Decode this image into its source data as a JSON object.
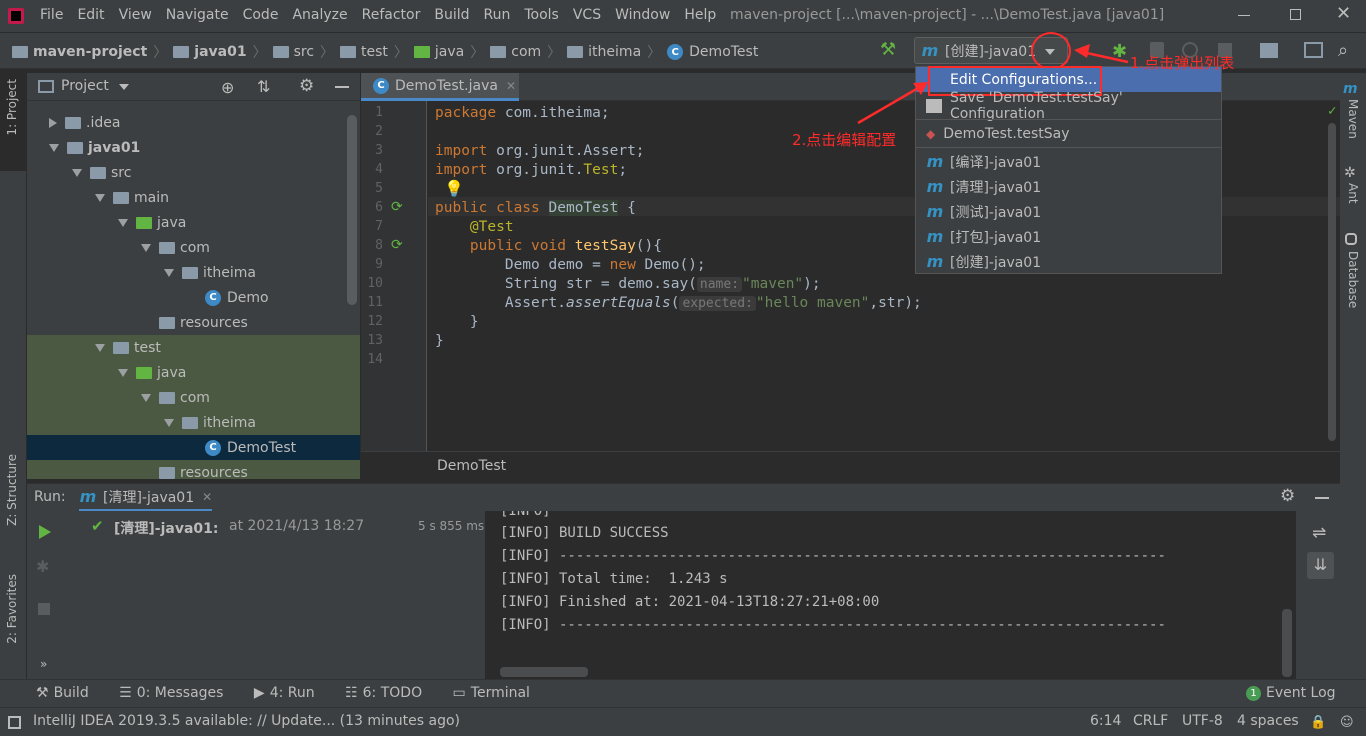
{
  "titlebar": {
    "menu": [
      "File",
      "Edit",
      "View",
      "Navigate",
      "Code",
      "Analyze",
      "Refactor",
      "Build",
      "Run",
      "Tools",
      "VCS",
      "Window",
      "Help"
    ],
    "window_title": "maven-project [...\\maven-project] - ...\\DemoTest.java [java01]"
  },
  "breadcrumbs": [
    "maven-project",
    "java01",
    "src",
    "test",
    "java",
    "com",
    "itheima",
    "DemoTest"
  ],
  "run_config": {
    "selected": "[创建]-java01"
  },
  "left_strip": {
    "project": "1: Project",
    "structure": "Z: Structure",
    "favorites": "2: Favorites"
  },
  "project_panel": {
    "title": "Project",
    "tree": [
      {
        "label": ".idea",
        "depth": 1,
        "expanded": false,
        "kind": "folder"
      },
      {
        "label": "java01",
        "depth": 1,
        "expanded": true,
        "kind": "module"
      },
      {
        "label": "src",
        "depth": 2,
        "expanded": true,
        "kind": "folder"
      },
      {
        "label": "main",
        "depth": 3,
        "expanded": true,
        "kind": "folder"
      },
      {
        "label": "java",
        "depth": 4,
        "expanded": true,
        "kind": "src"
      },
      {
        "label": "com",
        "depth": 5,
        "expanded": true,
        "kind": "pkg"
      },
      {
        "label": "itheima",
        "depth": 6,
        "expanded": true,
        "kind": "pkg"
      },
      {
        "label": "Demo",
        "depth": 7,
        "kind": "class"
      },
      {
        "label": "resources",
        "depth": 5,
        "kind": "res"
      },
      {
        "label": "test",
        "depth": 3,
        "expanded": true,
        "kind": "folder"
      },
      {
        "label": "java",
        "depth": 4,
        "expanded": true,
        "kind": "test"
      },
      {
        "label": "com",
        "depth": 5,
        "expanded": true,
        "kind": "pkg"
      },
      {
        "label": "itheima",
        "depth": 6,
        "expanded": true,
        "kind": "pkg"
      },
      {
        "label": "DemoTest",
        "depth": 7,
        "kind": "class",
        "selected": true
      },
      {
        "label": "resources",
        "depth": 5,
        "kind": "res"
      }
    ]
  },
  "editor": {
    "tab": "DemoTest.java",
    "status_breadcrumb": "DemoTest",
    "line_numbers": [
      "1",
      "2",
      "3",
      "4",
      "5",
      "6",
      "7",
      "8",
      "9",
      "10",
      "11",
      "12",
      "13",
      "14"
    ],
    "code": {
      "l1a": "package",
      "l1b": " com.itheima;",
      "l3a": "import",
      "l3b": " org.junit.Assert;",
      "l4a": "import",
      "l4b": " org.junit.",
      "l4c": "Test",
      ";": ";",
      "l6a": "public class ",
      "l6b": "DemoTest",
      " l6c": " {",
      "l7": "@Test",
      "l8a": "public void ",
      "l8b": "testSay",
      "l8c": "(){",
      "l9a": "Demo demo = ",
      "l9b": "new",
      "l9c": " Demo();",
      "l10a": "String str = demo.say(",
      "l10hint": "name:",
      "l10str": "\"maven\"",
      "l10end": ");",
      "l11a": "Assert.",
      "l11b": "assertEquals",
      "l11c": "(",
      "l11hint": "expected:",
      "l11str": "\"hello maven\"",
      "l11end": ",str);",
      "l12": "}",
      "l13": "}"
    }
  },
  "right_strip": {
    "maven": "Maven",
    "ant": "Ant",
    "database": "Database"
  },
  "popup": {
    "edit": "Edit Configurations...",
    "save": "Save 'DemoTest.testSay' Configuration",
    "demotest": "DemoTest.testSay",
    "items": [
      "[编译]-java01",
      "[清理]-java01",
      "[测试]-java01",
      "[打包]-java01",
      "[创建]-java01"
    ]
  },
  "annotations": {
    "a1": "1.点击弹出列表",
    "a2": "2.点击编辑配置"
  },
  "run_panel": {
    "label": "Run:",
    "tab": "[清理]-java01",
    "entry_name": "[清理]-java01:",
    "entry_time": "at 2021/4/13 18:27",
    "duration": "5 s 855 ms",
    "console": [
      "[INFO] BUILD SUCCESS",
      "[INFO] ------------------------------------------------------------------------",
      "[INFO] Total time:  1.243 s",
      "[INFO] Finished at: 2021-04-13T18:27:21+08:00",
      "[INFO] ------------------------------------------------------------------------"
    ],
    "console_partial": "[INFO]"
  },
  "bottom_tabs": {
    "build": "Build",
    "messages": "0: Messages",
    "run": "4: Run",
    "todo": "6: TODO",
    "terminal": "Terminal",
    "event_log": "Event Log",
    "event_count": "1"
  },
  "statusbar": {
    "message": "IntelliJ IDEA 2019.3.5 available: // Update... (13 minutes ago)",
    "position": "6:14",
    "line_sep": "CRLF",
    "encoding": "UTF-8",
    "indent": "4 spaces"
  },
  "colors": {
    "accent": "#4b6eaf",
    "selection": "#0d293e",
    "annotation": "#ff2b2b",
    "test_bg": "#4b5942"
  }
}
